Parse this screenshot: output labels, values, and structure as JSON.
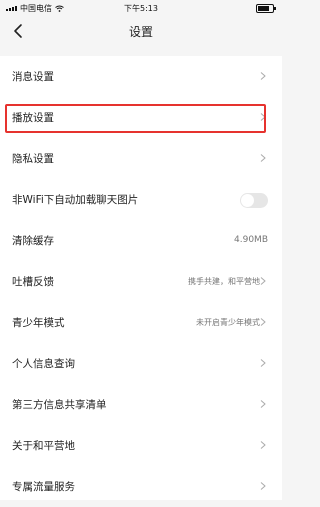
{
  "status_bar": {
    "carrier": "中国电信",
    "time": "下午5:13"
  },
  "header": {
    "title": "设置"
  },
  "settings": [
    {
      "label": "消息设置",
      "value": "",
      "control": "chevron"
    },
    {
      "label": "播放设置",
      "value": "",
      "control": "chevron",
      "highlighted": true
    },
    {
      "label": "隐私设置",
      "value": "",
      "control": "chevron"
    },
    {
      "label": "非WiFi下自动加载聊天图片",
      "value": "",
      "control": "toggle",
      "toggle_on": false
    },
    {
      "label": "清除缓存",
      "value": "4.90MB",
      "control": "none"
    },
    {
      "label": "吐槽反馈",
      "value": "携手共建，和平营地",
      "control": "chevron"
    },
    {
      "label": "青少年模式",
      "value": "未开启青少年模式",
      "control": "chevron"
    },
    {
      "label": "个人信息查询",
      "value": "",
      "control": "chevron"
    },
    {
      "label": "第三方信息共享清单",
      "value": "",
      "control": "chevron"
    },
    {
      "label": "关于和平营地",
      "value": "",
      "control": "chevron"
    },
    {
      "label": "专属流量服务",
      "value": "",
      "control": "chevron"
    }
  ],
  "colors": {
    "highlight": "#e6322e",
    "background": "#f5f5f5",
    "list_background": "#ffffff"
  }
}
